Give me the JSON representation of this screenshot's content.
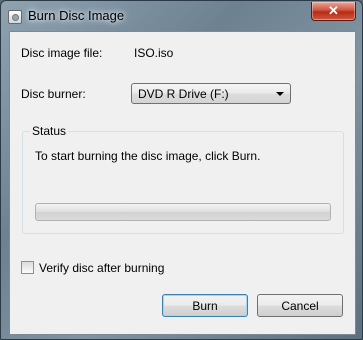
{
  "window": {
    "title": "Burn Disc Image",
    "close_glyph": "✕"
  },
  "fields": {
    "image_file_label": "Disc image file:",
    "image_file_value": "ISO.iso",
    "burner_label": "Disc burner:",
    "burner_selected": "DVD R Drive (F:)"
  },
  "status": {
    "legend": "Status",
    "message": "To start burning the disc image, click Burn.",
    "progress_fraction": 0
  },
  "verify": {
    "label": "Verify disc after burning",
    "checked": false
  },
  "buttons": {
    "burn": "Burn",
    "cancel": "Cancel"
  },
  "icons": {
    "app": "disc-burn-icon",
    "close": "close-icon",
    "dropdown": "chevron-down-icon"
  },
  "colors": {
    "close_red": "#c42b1c",
    "default_button_border": "#3c7fb1",
    "dialog_bg": "#f0f0f0"
  }
}
